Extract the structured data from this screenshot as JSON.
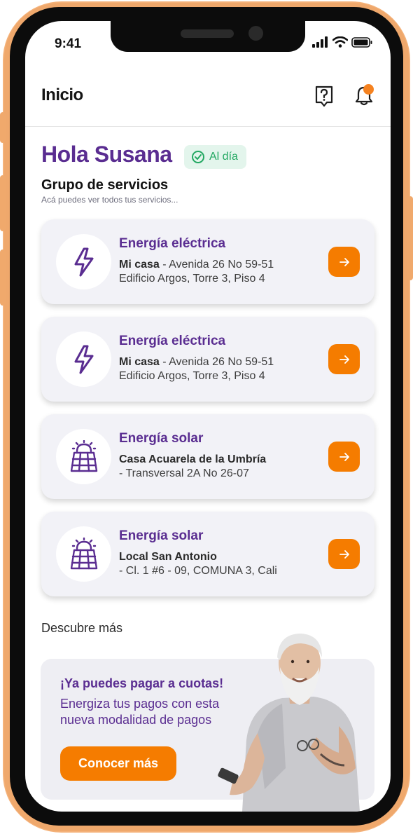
{
  "status_bar": {
    "time": "9:41"
  },
  "header": {
    "title": "Inicio"
  },
  "greeting": {
    "text": "Hola Susana",
    "status": "Al día"
  },
  "services": {
    "title": "Grupo de servicios",
    "subtitle": "Acá puedes ver todos tus servicios...",
    "items": [
      {
        "type": "Energía eléctrica",
        "icon": "lightning-icon",
        "name": "Mi casa",
        "address1": " - Avenida 26 No 59-51",
        "address2": "Edificio Argos, Torre 3, Piso 4"
      },
      {
        "type": "Energía eléctrica",
        "icon": "lightning-icon",
        "name": "Mi casa",
        "address1": " - Avenida 26 No 59-51",
        "address2": "Edificio Argos, Torre 3, Piso 4"
      },
      {
        "type": "Energía solar",
        "icon": "solar-panel-icon",
        "name": "Casa Acuarela de la Umbría",
        "address1": "",
        "address2": "- Transversal 2A No 26-07"
      },
      {
        "type": "Energía solar",
        "icon": "solar-panel-icon",
        "name": "Local San Antonio",
        "address1": "",
        "address2": "- Cl. 1 #6 - 09, COMUNA 3, Cali"
      }
    ]
  },
  "discover": {
    "title": "Descubre más",
    "promo": {
      "title": "¡Ya puedes pagar a cuotas!",
      "text": "Energiza tus pagos con esta nueva modalidad de pagos",
      "button": "Conocer más"
    }
  },
  "colors": {
    "brand_purple": "#5a2d91",
    "accent_orange": "#f57c00",
    "frame": "#f4b27a",
    "success_green": "#23a862"
  }
}
